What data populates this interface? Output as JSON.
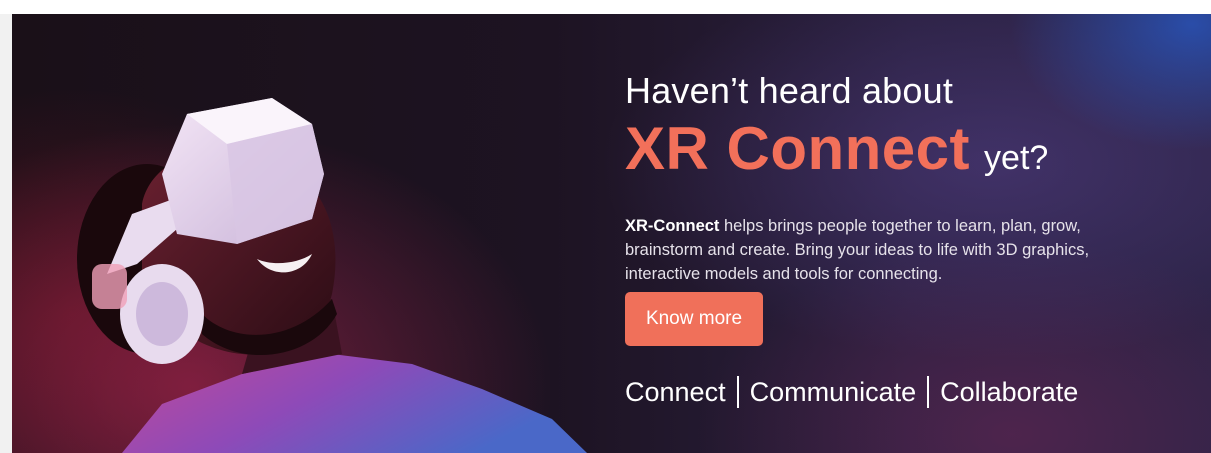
{
  "hero": {
    "headline": "Haven’t heard about",
    "brand_name": "XR Connect",
    "brand_suffix": "yet?",
    "description_lead": "XR-Connect",
    "description_rest": " helps brings people together to learn, plan, grow, brainstorm and create. Bring your ideas to life with 3D graphics, interactive models and tools for connecting.",
    "cta_label": "Know more",
    "tagline": [
      "Connect",
      "Communicate",
      "Collaborate"
    ]
  },
  "colors": {
    "accent": "#f0705a",
    "background": "#1d1322"
  },
  "icons": {
    "hero_image": "person-with-vr-headset-illustration"
  }
}
